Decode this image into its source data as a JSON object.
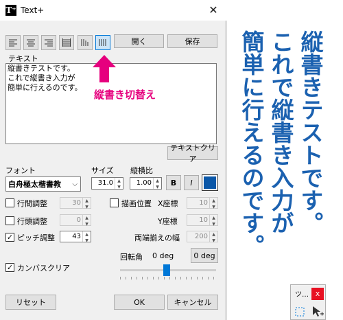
{
  "titlebar": {
    "title": "Text+",
    "app_icon_glyph": "T⁺",
    "close_glyph": "✕"
  },
  "toolbar": {
    "align_buttons": [
      "align-left-icon",
      "align-center-icon",
      "align-right-icon",
      "align-justify-icon"
    ],
    "horizontal_mode_icon": "horizontal-text-icon",
    "vertical_mode_icon": "vertical-text-icon",
    "open_label": "開く",
    "save_label": "保存"
  },
  "text_section": {
    "label": "テキスト",
    "lines": [
      "縦書きテストです。",
      "これで縦書き入力が",
      "簡単に行えるのです。"
    ],
    "annotation": "縦書き切替え",
    "annotation_color": "#e6007e",
    "clear_label": "テキストクリア"
  },
  "font": {
    "label": "フォント",
    "selected": "白舟極太楷書教",
    "size_label": "サイズ",
    "size_value": "31.0",
    "ratio_label": "縦横比",
    "ratio_value": "1.00",
    "bold_label": "B",
    "italic_label": "I",
    "color": "#0a57a8"
  },
  "options": {
    "line_spacing_label": "行間調整",
    "line_spacing_value": "30",
    "line_head_label": "行頭調整",
    "line_head_value": "0",
    "pitch_label": "ピッチ調整",
    "pitch_value": "43",
    "draw_position_label": "描画位置",
    "x_label": "X座標",
    "x_value": "10",
    "y_label": "Y座標",
    "y_value": "10",
    "width_label": "両端揃えの幅",
    "width_value": "200",
    "rotation_label": "回転角",
    "rotation_value": "0 deg",
    "rotation_button": "0 deg",
    "canvas_clear_label": "カンバスクリア"
  },
  "footer": {
    "reset_label": "リセット",
    "ok_label": "OK",
    "cancel_label": "キャンセル"
  },
  "canvas_text": {
    "columns": [
      "縦書きテストです。",
      "これで縦書き入力が",
      "簡単に行えるのです。"
    ],
    "color": "#1b61b0"
  },
  "mini_palette": {
    "title": "ツ…",
    "close_glyph": "x"
  }
}
